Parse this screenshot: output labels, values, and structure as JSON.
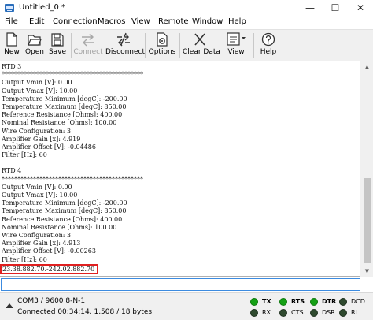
{
  "window": {
    "title": "Untitled_0 *",
    "minimize_icon": "minimize-icon",
    "maximize_icon": "maximize-icon",
    "close_icon": "close-icon"
  },
  "menu": [
    "File",
    "Edit",
    "Connection",
    "Macros",
    "View",
    "Remote",
    "Window",
    "Help"
  ],
  "toolbar": {
    "new": "New",
    "open": "Open",
    "save": "Save",
    "connect": "Connect",
    "disconnect": "Disconnect",
    "options": "Options",
    "clear_data": "Clear Data",
    "view": "View",
    "help": "Help"
  },
  "terminal": {
    "lines": [
      "RTD 3",
      "*********************************************",
      "Output Vmin [V]: 0.00",
      "Output Vmax [V]: 10.00",
      "Temperature Minimum [degC]: -200.00",
      "Temperature Maximum [degC]: 850.00",
      "Reference Resistance [Ohms]: 400.00",
      "Nominal Resistance [Ohms]: 100.00",
      "Wire Configuration: 3",
      "Amplifier Gain [x]: 4.919",
      "Amplifier Offset [V]: -0.04486",
      "Filter [Hz]: 60",
      "",
      "RTD 4",
      "*********************************************",
      "Output Vmin [V]: 0.00",
      "Output Vmax [V]: 10.00",
      "Temperature Minimum [degC]: -200.00",
      "Temperature Maximum [degC]: 850.00",
      "Reference Resistance [Ohms]: 400.00",
      "Nominal Resistance [Ohms]: 100.00",
      "Wire Configuration: 3",
      "Amplifier Gain [x]: 4.913",
      "Amplifier Offset [V]: -0.00263",
      "Filter [Hz]: 60"
    ],
    "highlighted_line": "23.38.882.70.-242.02.882.70"
  },
  "input": {
    "value": ""
  },
  "status": {
    "port": "COM3 / 9600 8-N-1",
    "connection": "Connected 00:34:14, 1,508 / 18 bytes",
    "signals": {
      "tx": "TX",
      "rx": "RX",
      "rts": "RTS",
      "cts": "CTS",
      "dtr": "DTR",
      "dsr": "DSR",
      "dcd": "DCD",
      "ri": "RI"
    },
    "led_on_color": "#14a014",
    "led_off_color": "#2f4a2f"
  }
}
